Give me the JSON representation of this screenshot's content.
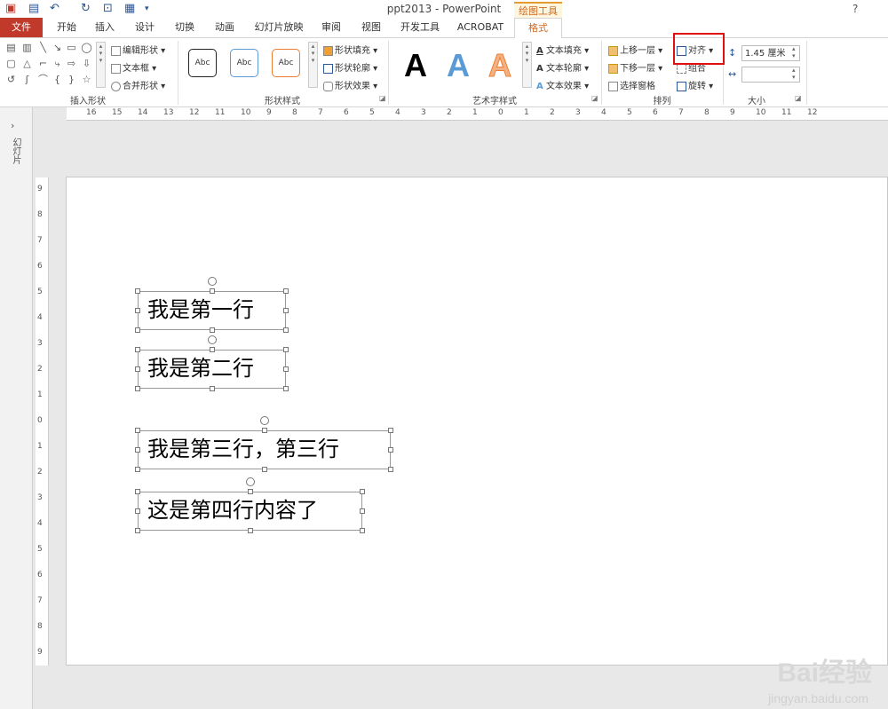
{
  "window": {
    "title": "ppt2013 - PowerPoint",
    "context_tab": "绘图工具",
    "help": "?"
  },
  "tabs": [
    "文件",
    "开始",
    "插入",
    "设计",
    "切换",
    "动画",
    "幻灯片放映",
    "审阅",
    "视图",
    "开发工具",
    "ACROBAT",
    "格式"
  ],
  "ribbon": {
    "insert_shapes": {
      "label": "插入形状",
      "edit_shape": "编辑形状",
      "text_box": "文本框",
      "merge_shapes": "合并形状"
    },
    "shape_styles": {
      "label": "形状样式",
      "preset": "Abc",
      "fill": "形状填充",
      "outline": "形状轮廓",
      "effects": "形状效果"
    },
    "wordart": {
      "label": "艺术字样式",
      "letter": "A",
      "text_fill": "文本填充",
      "text_outline": "文本轮廓",
      "text_effects": "文本效果"
    },
    "arrange": {
      "label": "排列",
      "bring_forward": "上移一层",
      "send_backward": "下移一层",
      "selection_pane": "选择窗格",
      "align": "对齐",
      "group": "组合",
      "rotate": "旋转"
    },
    "size": {
      "label": "大小",
      "height": "1.45 厘米",
      "width": ""
    }
  },
  "hruler": [
    "16",
    "15",
    "14",
    "13",
    "12",
    "11",
    "10",
    "9",
    "8",
    "7",
    "6",
    "5",
    "4",
    "3",
    "2",
    "1",
    "0",
    "1",
    "2",
    "3",
    "4",
    "5",
    "6",
    "7",
    "8",
    "9",
    "10",
    "11",
    "12"
  ],
  "vruler": [
    "9",
    "8",
    "7",
    "6",
    "5",
    "4",
    "3",
    "2",
    "1",
    "0",
    "1",
    "2",
    "3",
    "4",
    "5",
    "6",
    "7",
    "8",
    "9"
  ],
  "left_panel": {
    "label": "幻灯片"
  },
  "slide": {
    "textboxes": [
      "我是第一行",
      "我是第二行",
      "我是第三行，第三行",
      "这是第四行内容了"
    ]
  },
  "watermark": {
    "brand": "Bai经验",
    "url": "jingyan.baidu.com"
  },
  "colors": {
    "file_tab": "#c0392b",
    "format_tab": "#d2691e",
    "highlight": "#e01010"
  }
}
